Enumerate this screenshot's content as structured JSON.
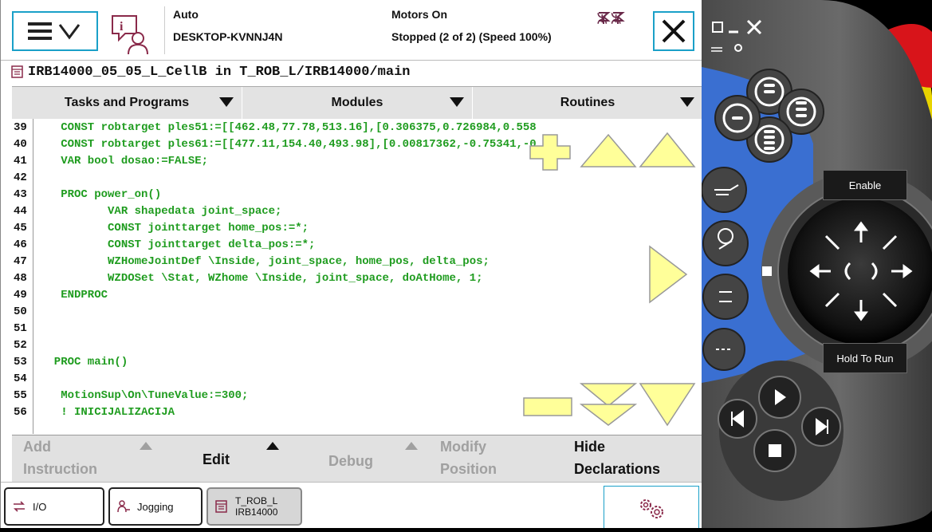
{
  "status": {
    "mode": "Auto",
    "host": "DESKTOP-KVNNJ4N",
    "motors": "Motors On",
    "state": "Stopped (2 of 2) (Speed 100%)"
  },
  "path": "IRB14000_05_05_L_CellB in T_ROB_L/IRB14000/main",
  "tabs": [
    {
      "label": "Tasks and Programs"
    },
    {
      "label": "Modules"
    },
    {
      "label": "Routines"
    }
  ],
  "code_lines": [
    {
      "num": "39",
      "text": "   CONST robtarget ples51:=[[462.48,77.78,513.16],[0.306375,0.726984,0.558"
    },
    {
      "num": "40",
      "text": "   CONST robtarget ples61:=[[477.11,154.40,493.98],[0.00817362,-0.75341,-0"
    },
    {
      "num": "41",
      "text": "   VAR bool dosao:=FALSE;"
    },
    {
      "num": "42",
      "text": ""
    },
    {
      "num": "43",
      "text": "   PROC power_on()"
    },
    {
      "num": "44",
      "text": "          VAR shapedata joint_space;"
    },
    {
      "num": "45",
      "text": "          CONST jointtarget home_pos:=*;"
    },
    {
      "num": "46",
      "text": "          CONST jointtarget delta_pos:=*;"
    },
    {
      "num": "47",
      "text": "          WZHomeJointDef \\Inside, joint_space, home_pos, delta_pos;"
    },
    {
      "num": "48",
      "text": "          WZDOSet \\Stat, WZhome \\Inside, joint_space, doAtHome, 1;"
    },
    {
      "num": "49",
      "text": "   ENDPROC"
    },
    {
      "num": "50",
      "text": ""
    },
    {
      "num": "51",
      "text": ""
    },
    {
      "num": "52",
      "text": ""
    },
    {
      "num": "53",
      "text": "  PROC main()"
    },
    {
      "num": "54",
      "text": ""
    },
    {
      "num": "55",
      "text": "   MotionSup\\On\\TuneValue:=300;"
    },
    {
      "num": "56",
      "text": "   ! INICIJALIZACIJA"
    }
  ],
  "toolbar": {
    "add_instruction_1": "Add",
    "add_instruction_2": "Instruction",
    "edit": "Edit",
    "debug": "Debug",
    "modify_1": "Modify",
    "modify_2": "Position",
    "hide_1": "Hide",
    "hide_2": "Declarations"
  },
  "taskbar": {
    "io": "I/O",
    "jogging": "Jogging",
    "task_1": "T_ROB_L",
    "task_2": "IRB14000"
  },
  "pendant": {
    "enable": "Enable",
    "hold_to_run": "Hold To Run"
  },
  "colors": {
    "accent": "#1aa0c8",
    "code": "#1f9c1f",
    "overlay": "#ffff99",
    "pendant_blue": "#3a6fd1"
  },
  "icons": [
    "abb-menu-icon",
    "chevron-down-icon",
    "info-person-icon",
    "close-icon",
    "motor-icon",
    "program-icon",
    "io-icon",
    "jogging-icon",
    "settings-icon"
  ]
}
